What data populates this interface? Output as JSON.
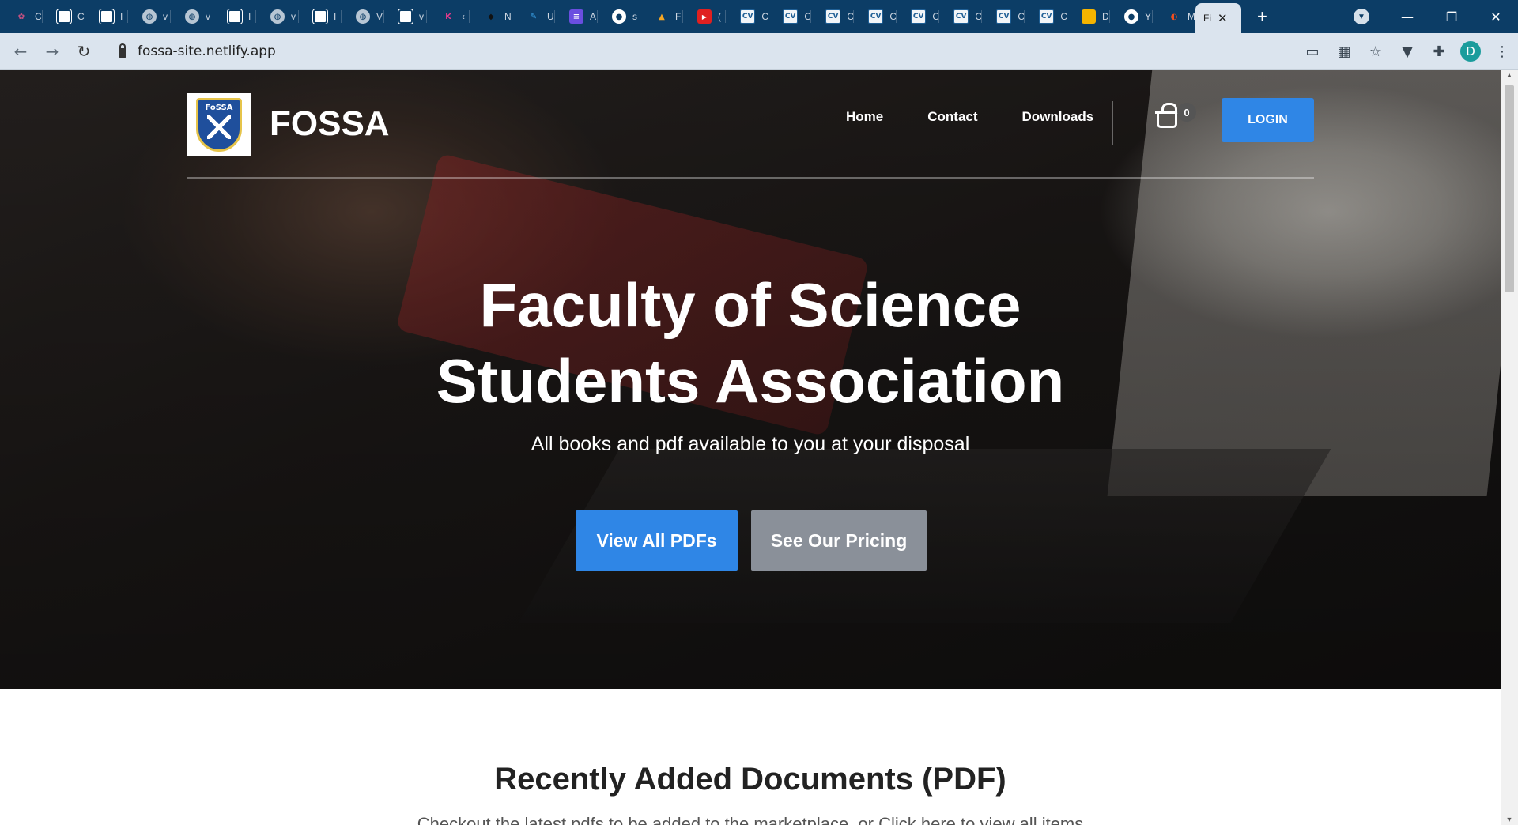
{
  "browser": {
    "tabs": [
      {
        "favicon": "pinwheel-icon",
        "label": "C"
      },
      {
        "favicon": "image-icon",
        "label": "C"
      },
      {
        "favicon": "image-icon",
        "label": "I"
      },
      {
        "favicon": "globe-icon",
        "label": "v"
      },
      {
        "favicon": "globe-icon",
        "label": "v"
      },
      {
        "favicon": "image-icon",
        "label": "I"
      },
      {
        "favicon": "globe-icon",
        "label": "v"
      },
      {
        "favicon": "image-icon",
        "label": "I"
      },
      {
        "favicon": "globe-icon",
        "label": "V"
      },
      {
        "favicon": "image-icon",
        "label": "v"
      },
      {
        "favicon": "k-icon",
        "label": "‹"
      },
      {
        "favicon": "elephant-icon",
        "label": "N"
      },
      {
        "favicon": "feather-icon",
        "label": "U"
      },
      {
        "favicon": "list-icon",
        "label": "A"
      },
      {
        "favicon": "github-icon",
        "label": "s"
      },
      {
        "favicon": "firebase-icon",
        "label": "F"
      },
      {
        "favicon": "youtube-icon",
        "label": "("
      },
      {
        "favicon": "cv-icon",
        "label": "C"
      },
      {
        "favicon": "cv-icon",
        "label": "C"
      },
      {
        "favicon": "cv-icon",
        "label": "C"
      },
      {
        "favicon": "cv-icon",
        "label": "C"
      },
      {
        "favicon": "cv-icon",
        "label": "C"
      },
      {
        "favicon": "cv-icon",
        "label": "C"
      },
      {
        "favicon": "cv-icon",
        "label": "C"
      },
      {
        "favicon": "cv-icon",
        "label": "C"
      },
      {
        "favicon": "sticky-icon",
        "label": "D"
      },
      {
        "favicon": "github-icon",
        "label": "Y"
      },
      {
        "favicon": "figma-icon",
        "label": "M"
      }
    ],
    "active_tab": {
      "label": "Fi"
    },
    "url": "fossa-site.netlify.app",
    "profile_initial": "D"
  },
  "site": {
    "brand": "FOSSA",
    "logo_text": "FoSSA",
    "nav": {
      "home": "Home",
      "contact": "Contact",
      "downloads": "Downloads"
    },
    "cart_count": "0",
    "login": "LOGIN",
    "hero": {
      "title": "Faculty of Science Students Association",
      "subtitle": "All books and pdf available to you at your disposal",
      "primary_button": "View All PDFs",
      "secondary_button": "See Our Pricing"
    },
    "section": {
      "title": "Recently Added Documents (PDF)",
      "subtitle": "Checkout the latest pdfs to be added to the marketplace, or Click here to view all items"
    }
  },
  "colors": {
    "tabstrip": "#0c3d66",
    "accent": "#2f86e6",
    "secondary_button": "#8a9099"
  }
}
